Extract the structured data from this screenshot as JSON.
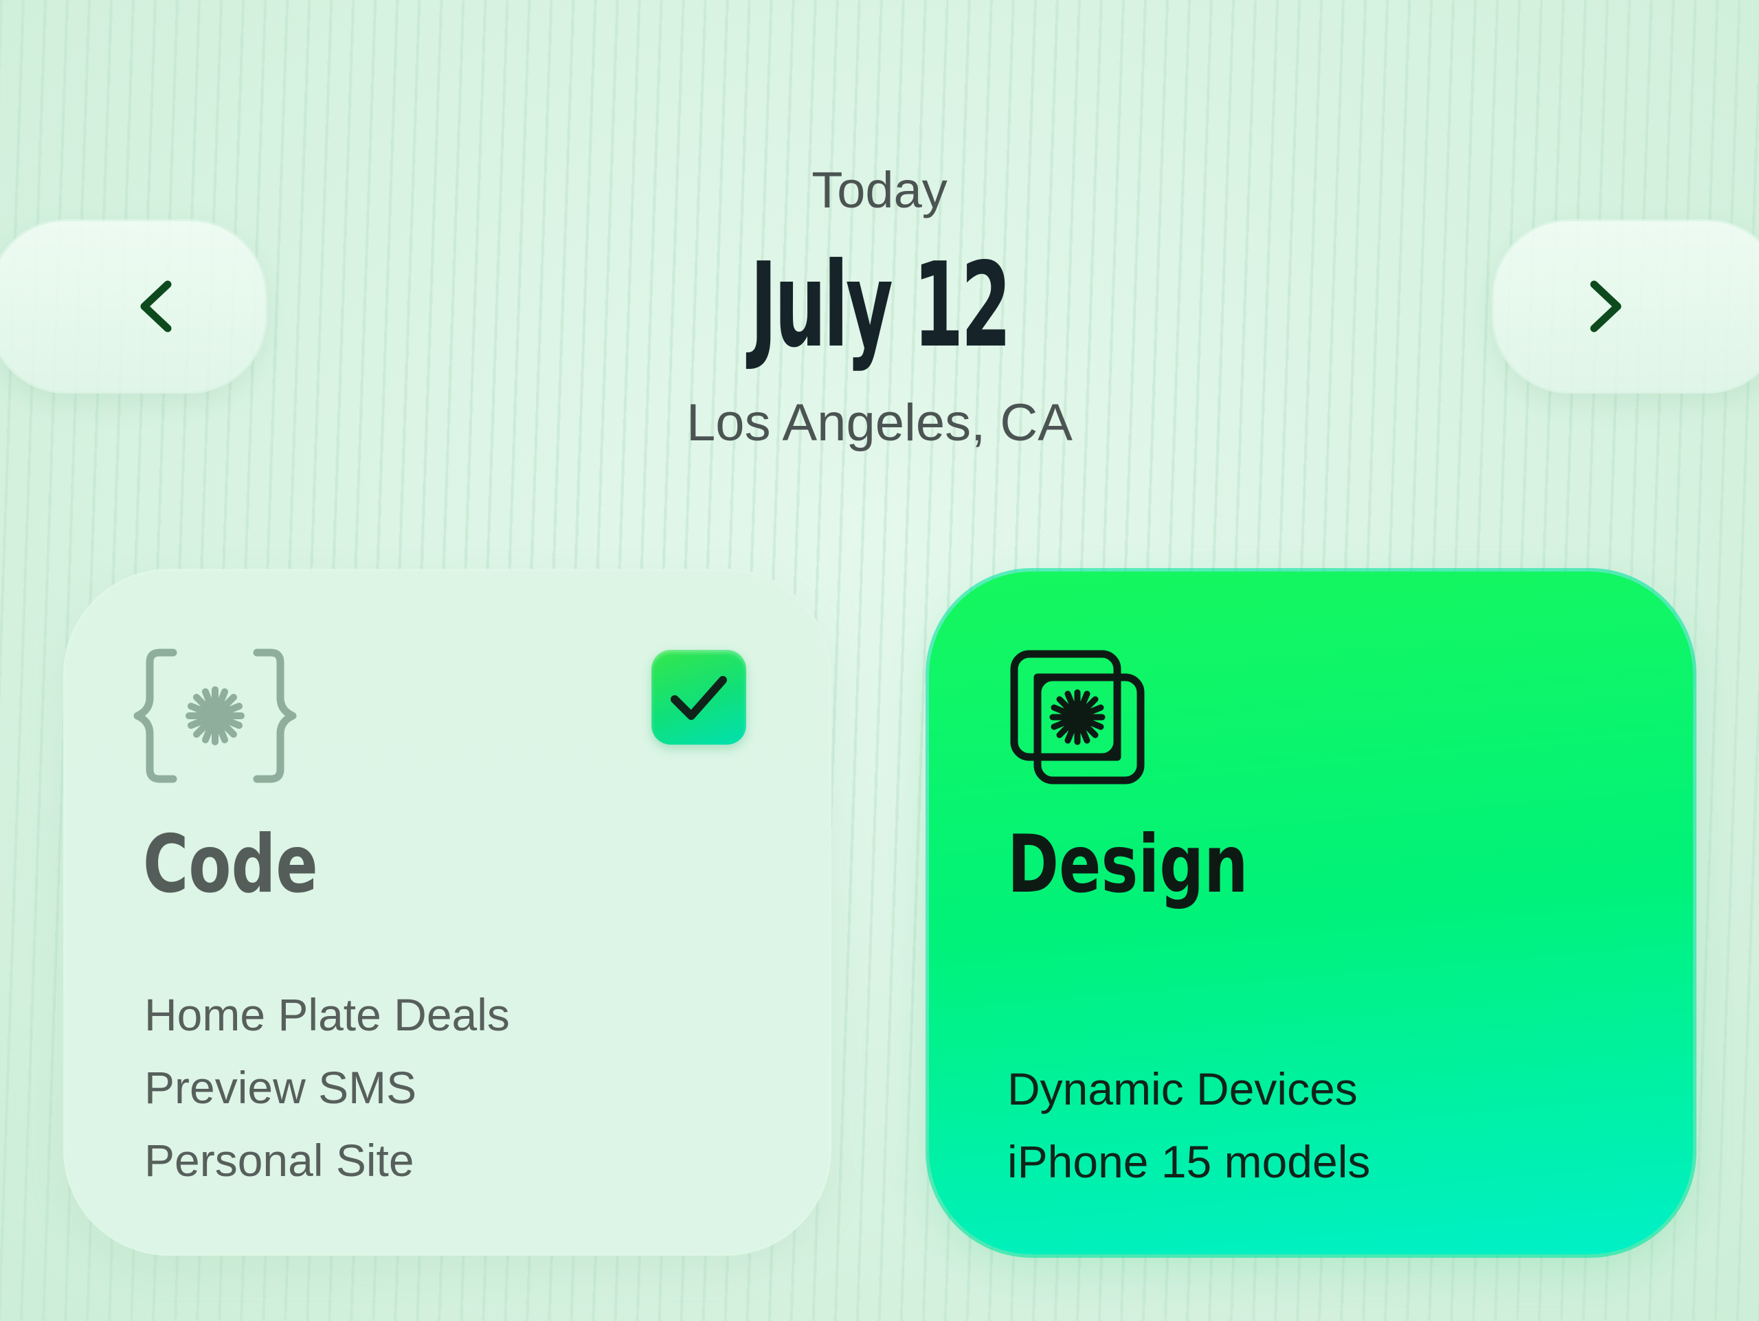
{
  "header": {
    "today_label": "Today",
    "date": "July 12",
    "location": "Los Angeles, CA"
  },
  "nav": {
    "prev_icon": "chevron-left-icon",
    "next_icon": "chevron-right-icon"
  },
  "cards": [
    {
      "title": "Code",
      "icon": "code-braces-icon",
      "checked": true,
      "items": [
        "Home Plate Deals",
        "Preview SMS",
        "Personal Site"
      ]
    },
    {
      "title": "Design",
      "icon": "design-frames-icon",
      "checked": false,
      "items": [
        "Dynamic Devices",
        "iPhone 15 models"
      ]
    }
  ],
  "colors": {
    "background": "#d7f3e1",
    "accent_green": "#16f75e",
    "accent_teal": "#00f0c8",
    "chevron": "#0d4a1e",
    "text_dark": "#16242a",
    "text_muted": "#575f5c"
  }
}
